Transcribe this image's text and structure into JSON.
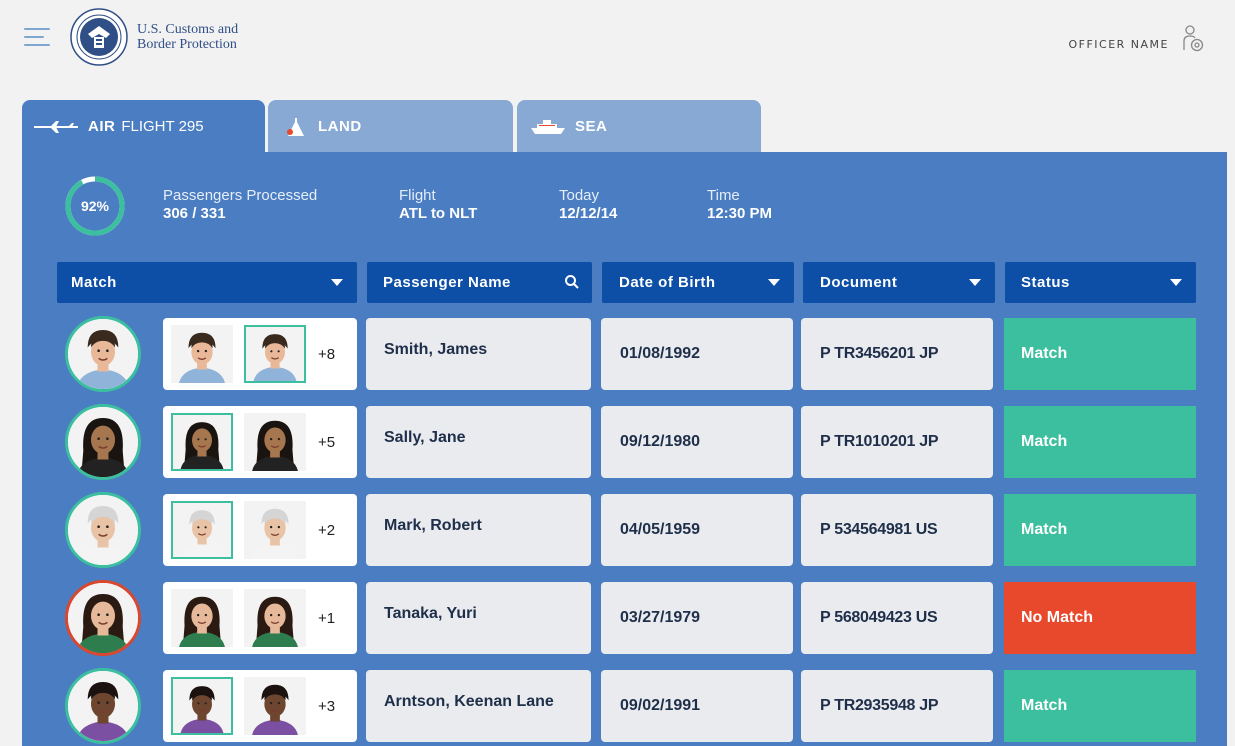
{
  "header": {
    "agency_line1": "U.S. Customs and",
    "agency_line2": "Border Protection",
    "officer_name": "OFFICER NAME"
  },
  "tabs": [
    {
      "mode": "AIR",
      "detail": "FLIGHT 295",
      "icon": "airplane-icon",
      "active": true
    },
    {
      "mode": "LAND",
      "detail": "",
      "icon": "land-icon",
      "active": false
    },
    {
      "mode": "SEA",
      "detail": "",
      "icon": "ship-icon",
      "active": false
    }
  ],
  "summary": {
    "progress_percent": 92,
    "progress_label": "92%",
    "passengers_label": "Passengers Processed",
    "passengers_value": "306 / 331",
    "flight_label": "Flight",
    "flight_value": "ATL to NLT",
    "today_label": "Today",
    "today_value": "12/12/14",
    "time_label": "Time",
    "time_value": "12:30 PM"
  },
  "columns": {
    "match": "Match",
    "name": "Passenger Name",
    "dob": "Date of Birth",
    "document": "Document",
    "status": "Status"
  },
  "colors": {
    "match": "#3cbf9e",
    "no_match": "#e8482c",
    "panel": "#4a7dc1",
    "header": "#0d4ea6"
  },
  "passengers": [
    {
      "name": "Smith, James",
      "dob": "01/08/1992",
      "document": "P TR3456201 JP",
      "status": "Match",
      "more": "+8",
      "match": true
    },
    {
      "name": "Sally, Jane",
      "dob": "09/12/1980",
      "document": "P TR1010201 JP",
      "status": "Match",
      "more": "+5",
      "match": true
    },
    {
      "name": "Mark, Robert",
      "dob": "04/05/1959",
      "document": "P 534564981 US",
      "status": "Match",
      "more": "+2",
      "match": true
    },
    {
      "name": "Tanaka, Yuri",
      "dob": "03/27/1979",
      "document": "P 568049423 US",
      "status": "No Match",
      "more": "+1",
      "match": false
    },
    {
      "name": "Arntson, Keenan Lane",
      "dob": "09/02/1991",
      "document": "P TR2935948 JP",
      "status": "Match",
      "more": "+3",
      "match": true
    }
  ]
}
